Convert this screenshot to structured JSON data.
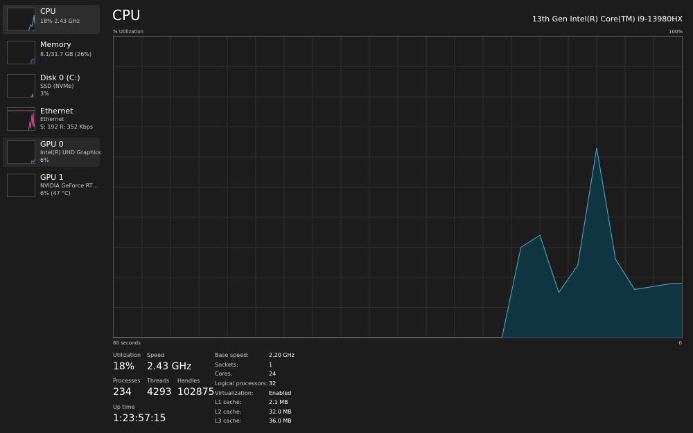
{
  "sidebar": {
    "items": [
      {
        "name": "CPU",
        "lines": [
          "18%  2.43 GHz"
        ],
        "state": "selected",
        "color": "#4fb3c8"
      },
      {
        "name": "Memory",
        "lines": [
          "8.1/31.7 GB (26%)"
        ],
        "state": "normal",
        "color": "#4f72c8"
      },
      {
        "name": "Disk 0 (C:)",
        "lines": [
          "SSD (NVMe)",
          "3%"
        ],
        "state": "normal",
        "color": "#8fb34f"
      },
      {
        "name": "Ethernet",
        "lines": [
          "Ethernet",
          "S: 192  R: 352 Kbps"
        ],
        "state": "normal",
        "color": "#c84f8f"
      },
      {
        "name": "GPU 0",
        "lines": [
          "Intel(R) UHD Graphics",
          "6%"
        ],
        "state": "hover",
        "color": "#a24fc8"
      },
      {
        "name": "GPU 1",
        "lines": [
          "NVIDIA GeForce RTX ...",
          "6% (47 °C)"
        ],
        "state": "normal",
        "color": "#a24fc8"
      }
    ]
  },
  "header": {
    "title": "CPU",
    "model": "13th Gen Intel(R) Core(TM) i9-13980HX"
  },
  "graph": {
    "y_label": "% Utilization",
    "y_max_label": "100%",
    "x_left_label": "60 seconds",
    "x_right_label": "0",
    "line_color": "#4fb3c8",
    "fill_color": "#0f3640",
    "grid_color": "#2e2e2e"
  },
  "chart_data": {
    "type": "area",
    "x": [
      60,
      50,
      19,
      17,
      15,
      13,
      11,
      9,
      7,
      5,
      3,
      1,
      0
    ],
    "values": [
      0,
      0,
      0,
      30,
      34,
      15,
      24,
      63,
      26,
      16,
      17,
      18,
      18
    ],
    "ylim": [
      0,
      100
    ],
    "xlim": [
      60,
      0
    ],
    "y_label": "% Utilization",
    "grid": true
  },
  "stats": {
    "utilization": {
      "label": "Utilization",
      "value": "18%"
    },
    "speed": {
      "label": "Speed",
      "value": "2.43 GHz"
    },
    "processes": {
      "label": "Processes",
      "value": "234"
    },
    "threads": {
      "label": "Threads",
      "value": "4293"
    },
    "handles": {
      "label": "Handles",
      "value": "102875"
    },
    "uptime": {
      "label": "Up time",
      "value": "1:23:57:15"
    }
  },
  "details": [
    {
      "key": "Base speed:",
      "value": "2.20 GHz"
    },
    {
      "key": "Sockets:",
      "value": "1"
    },
    {
      "key": "Cores:",
      "value": "24"
    },
    {
      "key": "Logical processors:",
      "value": "32"
    },
    {
      "key": "Virtualization:",
      "value": "Enabled"
    },
    {
      "key": "L1 cache:",
      "value": "2.1 MB"
    },
    {
      "key": "L2 cache:",
      "value": "32.0 MB"
    },
    {
      "key": "L3 cache:",
      "value": "36.0 MB"
    }
  ]
}
